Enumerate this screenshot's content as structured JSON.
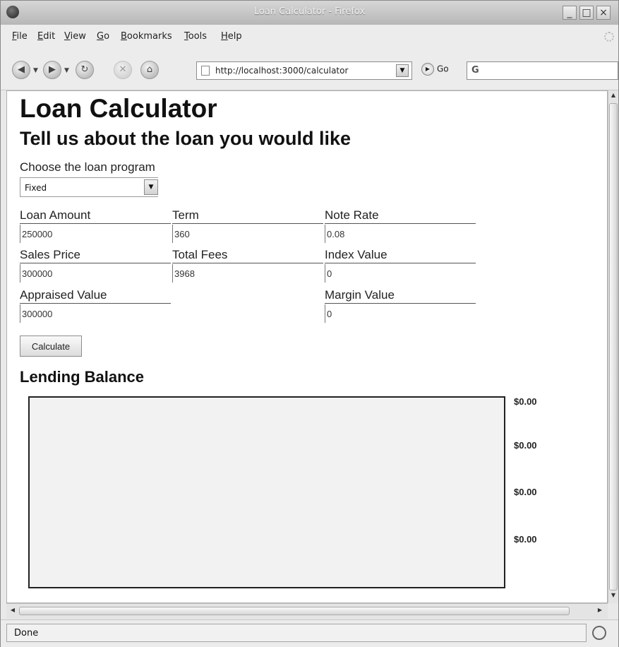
{
  "window": {
    "title": "Loan Calculator - Firefox"
  },
  "menu": [
    "File",
    "Edit",
    "View",
    "Go",
    "Bookmarks",
    "Tools",
    "Help"
  ],
  "nav": {
    "url": "http://localhost:3000/calculator",
    "go_label": "Go",
    "search_engine": "G"
  },
  "page": {
    "title": "Loan Calculator",
    "subtitle": "Tell us about the loan you would like",
    "program_label": "Choose the loan program",
    "program_value": "Fixed",
    "fields": {
      "loan_amount": {
        "label": "Loan Amount",
        "value": "250000"
      },
      "term": {
        "label": "Term",
        "value": "360"
      },
      "note_rate": {
        "label": "Note Rate",
        "value": "0.08"
      },
      "sales_price": {
        "label": "Sales Price",
        "value": "300000"
      },
      "total_fees": {
        "label": "Total Fees",
        "value": "3968"
      },
      "index_value": {
        "label": "Index Value",
        "value": "0"
      },
      "appraised_value": {
        "label": "Appraised Value",
        "value": "300000"
      },
      "margin_value": {
        "label": "Margin Value",
        "value": "0"
      }
    },
    "calculate_label": "Calculate",
    "lending_title": "Lending Balance",
    "balances": [
      "$0.00",
      "$0.00",
      "$0.00",
      "$0.00"
    ]
  },
  "status": {
    "text": "Done"
  }
}
